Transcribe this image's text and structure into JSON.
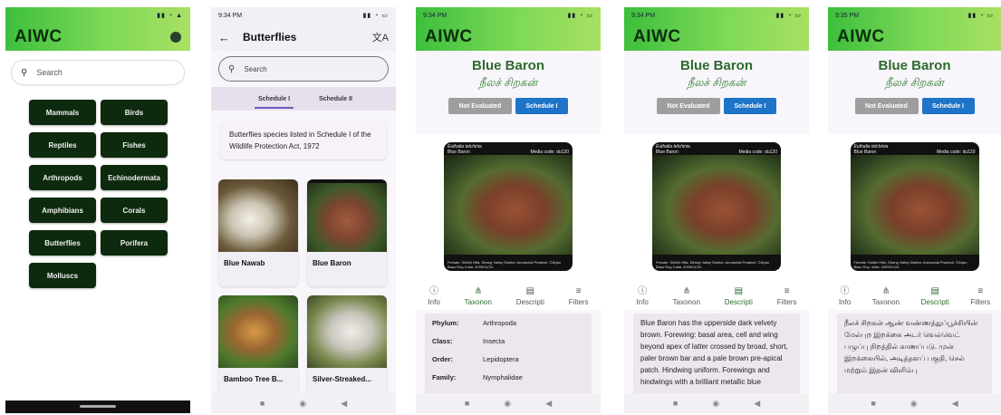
{
  "phone1": {
    "app_title": "AIWC",
    "search_placeholder": "Search",
    "categories": [
      "Mammals",
      "Birds",
      "Reptiles",
      "Fishes",
      "Arthropods",
      "Echinodermata",
      "Amphibians",
      "Corals",
      "Butterflies",
      "Porifera",
      "Molluscs"
    ]
  },
  "phone2": {
    "time": "9:34 PM",
    "title": "Butterflies",
    "search_placeholder": "Search",
    "tab1": "Schedule I",
    "tab2": "Schedule II",
    "info": "Butterflies species listed in Schedule I of the Wildlife Protection Act, 1972",
    "species": [
      "Blue Nawab",
      "Blue Baron",
      "Bamboo Tree B...",
      "Silver-Streaked..."
    ]
  },
  "detail": {
    "app_title": "AIWC",
    "time_a": "9:34 PM",
    "time_b": "9:35 PM",
    "name": "Blue Baron",
    "tamil": "நீலச் சிறகன்",
    "status": "Not Evaluated",
    "schedule": "Schedule I",
    "photo_species": "Euthalia telchinia",
    "photo_name": "Blue Baron",
    "media_code": "Media code: du120",
    "photo_credit": "Female. Siddhi Hills, Dirang Valley District, Arunachal Pradesh. ©Arjan Basu Roy, India. 2009/11/24.",
    "tabs": [
      "Info",
      "Taxonon",
      "Descripti",
      "Filters"
    ],
    "taxonomy": [
      {
        "k": "Phylum:",
        "v": "Arthropoda"
      },
      {
        "k": "Class:",
        "v": "Insecta"
      },
      {
        "k": "Order:",
        "v": "Lepidoptera"
      },
      {
        "k": "Family:",
        "v": "Nymphalidae"
      }
    ],
    "description_en": "Blue Baron has the upperside dark velvety brown. Forewing: basal area, cell and wing beyond apex of latter crossed by broad, short, paler brown bar and a pale brown pre-apical patch. Hindwing uniform. Forewings and hindwings with a brilliant metallic blue",
    "description_ta": "நீலச் சிறகன் ஆண் வண்ணத்துப்பூச்சியின் மேல்புற இறக்கை அடர் வெல்வெட் பழுப்பு நிறத்தில் காணப்படு. முன் இறக்கையில், அடித்தளப் பகுதி, செல் மற்றும் இதன் விளிம்பு"
  },
  "colors": {
    "accent_green": "#2e6b2e",
    "dark_button": "#0e2a0e",
    "schedule_blue": "#1e74c8"
  }
}
